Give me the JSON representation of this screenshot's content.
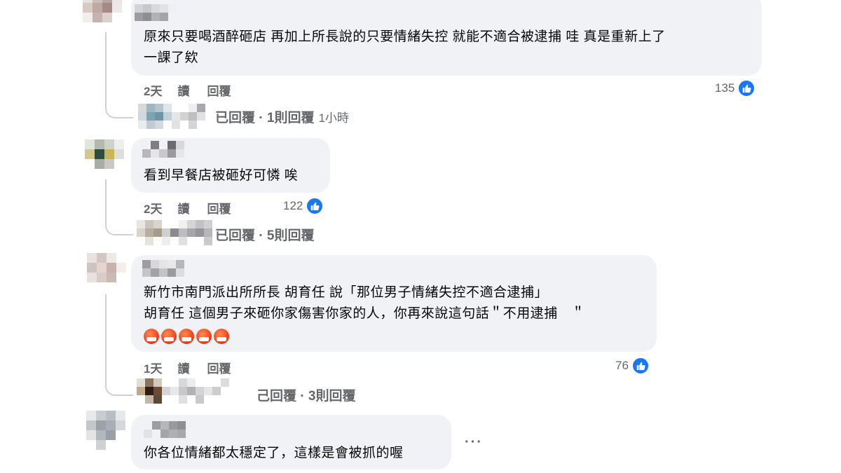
{
  "comments": [
    {
      "text_lines": [
        "原來只要喝酒醉砸店 再加上所長說的只要情緒失控 就能不適合被逮捕 哇 真是重新上了",
        "一課了欸"
      ],
      "time": "2天",
      "read_label": "讀",
      "reply_label": "回覆",
      "likes": "135",
      "replies_text": "已回覆 · 1則回覆",
      "replies_time": "1小時"
    },
    {
      "text_lines": [
        "看到早餐店被砸好可憐 唉"
      ],
      "time": "2天",
      "read_label": "讀",
      "reply_label": "回覆",
      "likes": "122",
      "replies_text": "已回覆 · 5則回覆"
    },
    {
      "text_lines": [
        "新竹市南門派出所所長 胡育任 說「那位男子情緒失控不適合逮捕」",
        "胡育任 這個男子來砸你家傷害你家的人，你再來說這句話＂不用逮捕　＂"
      ],
      "emoji_count": 5,
      "time": "1天",
      "read_label": "讀",
      "reply_label": "回覆",
      "likes": "76",
      "replies_text": "己回覆 · 3則回覆"
    },
    {
      "text_lines": [
        "你各位情緒都太穩定了，這樣是會被抓的喔"
      ],
      "more_label": "···"
    }
  ],
  "colors": {
    "bubble": "#f0f2f5",
    "meta_text": "#65676b",
    "like_blue": "#1877f2",
    "emoji_red": "#e8391e"
  },
  "icons": {
    "like": "thumbs-up-icon",
    "angry": "angry-face-emoji",
    "more": "more-options-icon"
  }
}
